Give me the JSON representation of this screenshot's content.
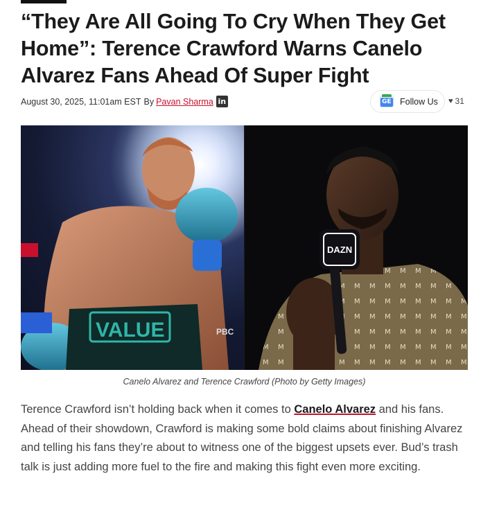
{
  "article": {
    "title": "“They Are All Going To Cry When They Get Home”: Terence Crawford Warns Canelo Alvarez Fans Ahead Of Super Fight",
    "date": "August 30, 2025, 11:01am EST",
    "by_label": "By",
    "author": "Pavan Sharma",
    "linkedin_glyph": "in",
    "follow_label": "Follow Us",
    "likes_count": "31",
    "image_caption": "Canelo Alvarez and Terence Crawford (Photo by Getty Images)",
    "image_text": {
      "left_trunks": "VALUE",
      "left_logo": "PBC",
      "right_mic": "DAZN"
    },
    "body": {
      "before_link": "Terence Crawford isn’t holding back when it comes to ",
      "link_text": "Canelo Alvarez",
      "after_link": " and his fans. Ahead of their showdown, Crawford is making some bold claims about finishing Alvarez and telling his fans they’re about to witness one of the biggest upsets ever. Bud’s trash talk is just adding more fuel to the fire and making this fight even more exciting."
    }
  },
  "colors": {
    "accent_red": "#c8102e",
    "text_dark": "#1b1b1b",
    "text_body": "#444444"
  },
  "icons": {
    "linkedin": "linkedin-icon",
    "google_news": "google-news-icon",
    "heart": "heart-icon"
  }
}
